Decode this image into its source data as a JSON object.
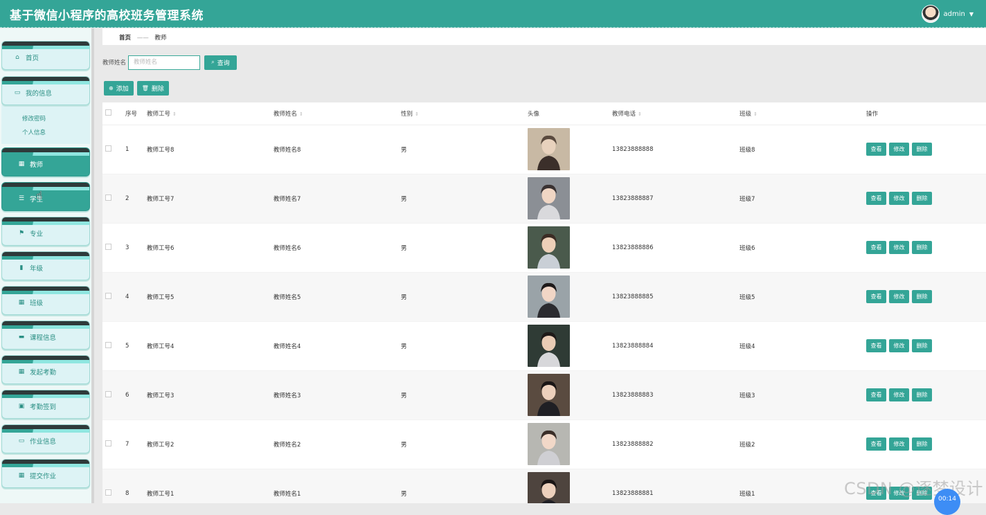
{
  "header": {
    "title": "基于微信小程序的高校班务管理系统",
    "username": "admin"
  },
  "sidebar": {
    "home": "首页",
    "my_info": "我的信息",
    "sub": [
      "修改密码",
      "个人信息"
    ],
    "items": [
      {
        "label": "教师",
        "icon": "grid-icon"
      },
      {
        "label": "学生",
        "icon": "sliders-icon"
      },
      {
        "label": "专业",
        "icon": "flag-icon"
      },
      {
        "label": "年级",
        "icon": "bar-chart-icon"
      },
      {
        "label": "班级",
        "icon": "grid-icon"
      },
      {
        "label": "课程信息",
        "icon": "book-icon"
      },
      {
        "label": "发起考勤",
        "icon": "grid-icon"
      },
      {
        "label": "考勤签到",
        "icon": "clipboard-icon"
      },
      {
        "label": "作业信息",
        "icon": "monitor-icon"
      },
      {
        "label": "提交作业",
        "icon": "grid-icon"
      }
    ]
  },
  "breadcrumb": {
    "home": "首页",
    "sep": "——",
    "current": "教师"
  },
  "search": {
    "label": "教师姓名",
    "placeholder": "教师姓名",
    "button": "查询"
  },
  "actions": {
    "add": "添加",
    "delete": "删除"
  },
  "table": {
    "columns": [
      "序号",
      "教师工号",
      "教师姓名",
      "性别",
      "头像",
      "教师电话",
      "班级",
      "操作"
    ],
    "op_labels": {
      "view": "查看",
      "edit": "修改",
      "delete": "删除"
    },
    "rows": [
      {
        "no": "1",
        "id": "教师工号8",
        "name": "教师姓名8",
        "gender": "男",
        "phone": "13823888888",
        "class": "班级8"
      },
      {
        "no": "2",
        "id": "教师工号7",
        "name": "教师姓名7",
        "gender": "男",
        "phone": "13823888887",
        "class": "班级7"
      },
      {
        "no": "3",
        "id": "教师工号6",
        "name": "教师姓名6",
        "gender": "男",
        "phone": "13823888886",
        "class": "班级6"
      },
      {
        "no": "4",
        "id": "教师工号5",
        "name": "教师姓名5",
        "gender": "男",
        "phone": "13823888885",
        "class": "班级5"
      },
      {
        "no": "5",
        "id": "教师工号4",
        "name": "教师姓名4",
        "gender": "男",
        "phone": "13823888884",
        "class": "班级4"
      },
      {
        "no": "6",
        "id": "教师工号3",
        "name": "教师姓名3",
        "gender": "男",
        "phone": "13823888883",
        "class": "班级3"
      },
      {
        "no": "7",
        "id": "教师工号2",
        "name": "教师姓名2",
        "gender": "男",
        "phone": "13823888882",
        "class": "班级2"
      },
      {
        "no": "8",
        "id": "教师工号1",
        "name": "教师姓名1",
        "gender": "男",
        "phone": "13823888881",
        "class": "班级1"
      }
    ]
  },
  "overlay": {
    "watermark": "CSDN @逐梦设计",
    "timer": "00:14"
  },
  "colors": {
    "accent": "#34a597"
  }
}
